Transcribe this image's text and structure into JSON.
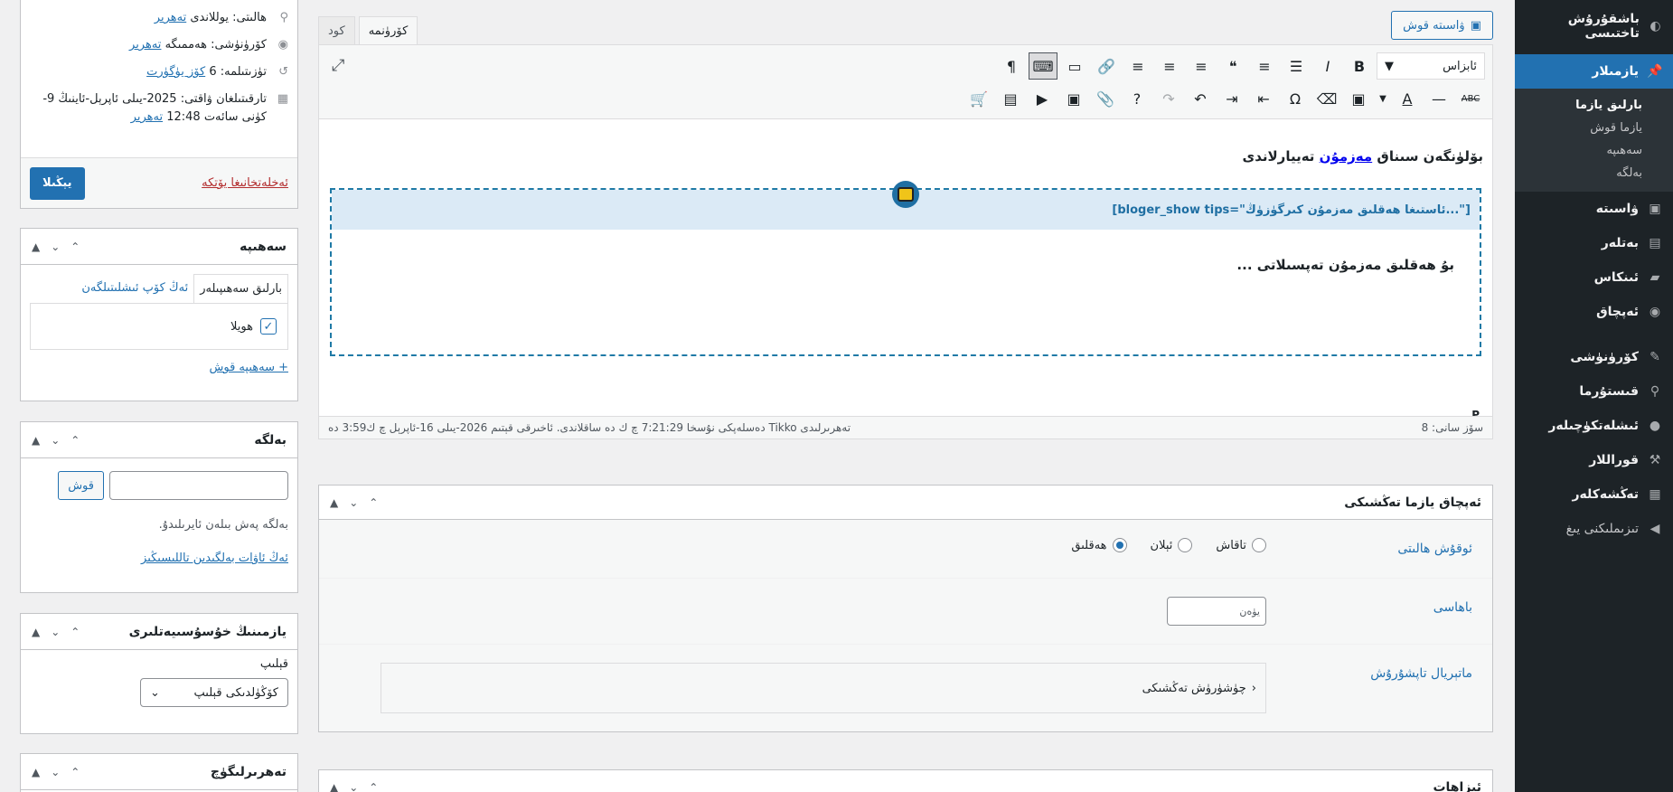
{
  "admin_menu": {
    "dashboard": "باشقۇرۇش تاختىسى",
    "posts": "يازمىلار",
    "submenu": [
      "بارلىق يازما",
      "يازما قوش",
      "سەھىپە",
      "بەلگە"
    ],
    "media": "ۋاسىتە",
    "pages": "بەتلەر",
    "comments": "ئىنكاس",
    "accessibility": "ئەپچاق",
    "appearance": "كۆرۈنۈشى",
    "plugins": "قىستۇرما",
    "users": "ئىشلەتكۈچىلەر",
    "tools": "قوراللار",
    "settings": "تەڭشەكلەر",
    "collapse": "تىزىملىكنى يىغ"
  },
  "editor": {
    "add_media": "ۋاسىتە قوش",
    "tab_visual": "كۆرۈنمە",
    "tab_code": "كود",
    "format": "ئابزاس",
    "lead_prefix": "بۆلۈنگەن سىناق ",
    "lead_link": "مەزمۇن",
    "lead_suffix": " تەييارلاندى",
    "shortcode": "[bloger_show tips=\"ئاستىغا ھەقلىق مەزمۇن كىرگۈزۈڭ...\"]",
    "shortcode_body": "بۇ ھەقلىق مەزمۇن تەپسىلاتى ...",
    "path": "P",
    "word_count": "سۆز سانى: 8",
    "draft_info": "دەسلەپكى نۇسخا 7:21:29 چ ك دە ساقلاندى. ئاخىرقى قېتىم 2026-يىلى 16-ئاپرېل چ ك3:59 دە Tikko تەھرىرلىدى"
  },
  "access_box": {
    "title": "ئەپچاق يازما تەڭشىكى",
    "read_status_label": "ئوقۇش ھالىتى",
    "options": [
      "تاقاش",
      "ئېلان",
      "ھەقلىق"
    ],
    "selected": "ھەقلىق",
    "price_label": "باھاسى",
    "price_placeholder": "يۈەن",
    "material_label": "ماتېريال تاپشۇرۇش",
    "material_toggle": "چۈشۈرۈش تەڭشىكى"
  },
  "next_box_title": "ئىزاھات",
  "publish": {
    "status": "ھالىتى: يوللاندى",
    "status_edit": "تەھرىر",
    "visibility": "كۆرۈنۈشى: ھەممىگە",
    "visibility_edit": "تەھرىر",
    "revisions": "تۈزىتىلمە: 6",
    "revisions_link": "كۆز يۈگۈرت",
    "date": "تارقىتىلغان ۋاقتى: 2025-يىلى ئاپرېل-ئاينىڭ 9-كۈنى سائەت 12:48",
    "date_edit": "تەھرىر",
    "trash": "ئەخلەتخانىغا يۆتكە",
    "update": "يېڭىلا"
  },
  "categories": {
    "title": "سەھىپە",
    "tab_all": "بارلىق سەھىپىلەر",
    "tab_popular": "ئەڭ كۆپ ئىشلىتىلگەن",
    "item": "ھويلا",
    "add": "+ سەھىپە قوش"
  },
  "tags": {
    "title": "بەلگە",
    "add_button": "قوش",
    "note": "بەلگە پەش بىلەن ئايرىلىدۇ.",
    "choose": "ئەڭ ئاۋات بەلگىدىن تاللىسىڭىز"
  },
  "format_box": {
    "title": "يازمىنىڭ خۇسۇسىيەتلىرى",
    "label": "قېلىپ",
    "value": "كۆڭۈلدىكى قېلىپ"
  },
  "author_box": {
    "title": "تەھرىرلىگۈچ"
  }
}
